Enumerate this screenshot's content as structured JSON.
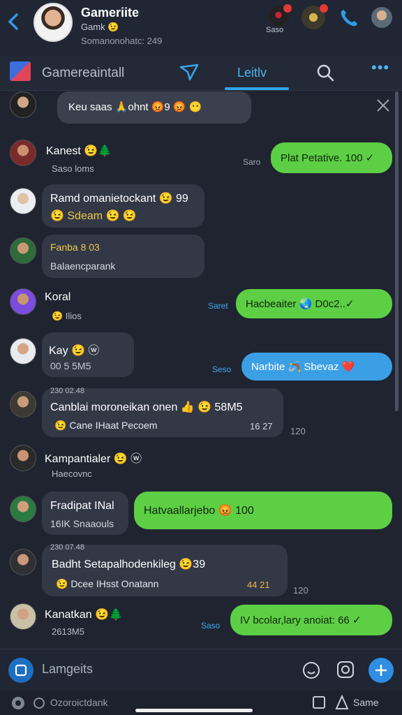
{
  "header": {
    "title": "Gameriite",
    "subtitle_1": "Gamk 😉",
    "subtitle_2": "Somanonohatc: 249",
    "action_label": "Saso"
  },
  "tabs": {
    "title": "Gamereaintall",
    "active_tab": "Leitlv"
  },
  "banner": {
    "text": "Keu saas 🙏ohnt 😡9 😡 😶"
  },
  "messages": [
    {
      "name": "Kanest 😉🌲",
      "meta": "Saso loms",
      "out_side": "Saro",
      "out_text": "Plat Petative. 100 ✓"
    },
    {
      "bubble_line1": "Ramd omanietockant 😉 99",
      "bubble_line2": "😉 Sdeam 😉 😉"
    },
    {
      "bubble_line1": "Fanba 8 03",
      "bubble_line2": "Balaencparank"
    },
    {
      "name": "Koral",
      "meta": "😉 Ilios",
      "out_side": "Saret",
      "out_text": "Hacbeaiter 🌏 D0c2..✓"
    },
    {
      "name": "Kay 😉 ⓦ",
      "meta": "00 5 5M5",
      "out_side": "Seso",
      "out_text": "Narbite 🪃 Sbevaz ❤️"
    },
    {
      "date": "230 02.48",
      "bubble_line1": "Canblai moroneikan onen 👍 😉 58M5",
      "bubble_line2": "😉 Cane IHaat Pecoem",
      "time_in": "16 27",
      "time_out": "120"
    },
    {
      "name": "Kampantialer 😉 ⓦ",
      "meta": "Haecovnc"
    },
    {
      "bubble_line1": "Fradipat INal",
      "bubble_line2": "16IK Snaaouls",
      "out_text": "Hatvaallarjebo 😡 100"
    },
    {
      "date": "230 07.48",
      "bubble_line1": "Badht Setapalhodenkileg 😉39",
      "bubble_line2": "😉 Dcee IHsst Onatann",
      "time_in": "44 21",
      "time_out": "120"
    },
    {
      "name": "Kanatkan 😉🌲",
      "meta": "2613M5",
      "out_side": "Saso",
      "out_text": "IV bcolar,lary anoiat: 66 ✓"
    }
  ],
  "composer": {
    "placeholder": "Lamgeits"
  },
  "bottom_bar": {
    "left_text": "Ozoroictdank",
    "right_text": "Same"
  },
  "colors": {
    "accent_blue": "#2fa5ec",
    "out_green": "#5dcf45",
    "out_blue": "#3b9fe6",
    "bubble_dark": "#323846"
  }
}
